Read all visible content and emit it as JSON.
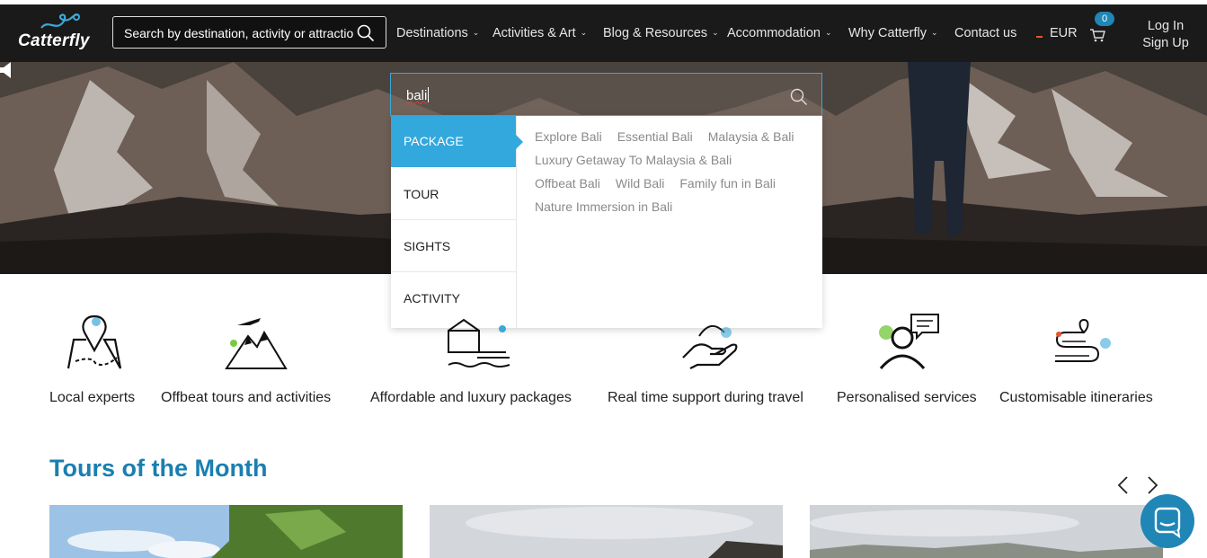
{
  "brand": {
    "logo_text": "Catterfly"
  },
  "header": {
    "search_placeholder": "Search by destination, activity or attraction",
    "nav": [
      {
        "label": "Destinations",
        "has_dropdown": true
      },
      {
        "label": "Activities & Art",
        "has_dropdown": true
      },
      {
        "label": "Blog & Resources",
        "has_dropdown": true
      },
      {
        "label": "Accommodation",
        "has_dropdown": true
      },
      {
        "label": "Why Catterfly",
        "has_dropdown": true
      },
      {
        "label": "Contact us",
        "has_dropdown": false
      }
    ],
    "currency": "EUR",
    "cart_count": "0",
    "login": "Log In",
    "signup": "Sign Up"
  },
  "search_dropdown": {
    "query": "bali",
    "categories": [
      {
        "label": "PACKAGE",
        "active": true
      },
      {
        "label": "TOUR",
        "active": false
      },
      {
        "label": "SIGHTS",
        "active": false
      },
      {
        "label": "ACTIVITY",
        "active": false
      }
    ],
    "results": [
      "Explore Bali",
      "Essential Bali",
      "Malaysia & Bali",
      "Luxury Getaway To Malaysia & Bali",
      "Offbeat Bali",
      "Wild Bali",
      "Family fun in Bali",
      "Nature Immersion in Bali"
    ]
  },
  "features": [
    {
      "label": "Local experts",
      "icon": "map-pin-icon"
    },
    {
      "label": "Offbeat tours and activities",
      "icon": "mountain-plane-icon"
    },
    {
      "label": "Affordable and luxury packages",
      "icon": "resort-icon"
    },
    {
      "label": "Real time support during travel",
      "icon": "hand-support-icon"
    },
    {
      "label": "Personalised services",
      "icon": "person-chat-icon"
    },
    {
      "label": "Customisable itineraries",
      "icon": "route-icon"
    }
  ],
  "tours": {
    "title": "Tours of the Month"
  },
  "colors": {
    "accent": "#33a8dd",
    "title": "#1a7fb0",
    "header_bg": "#1a1a1a",
    "currency_dash": "#e8562a"
  }
}
